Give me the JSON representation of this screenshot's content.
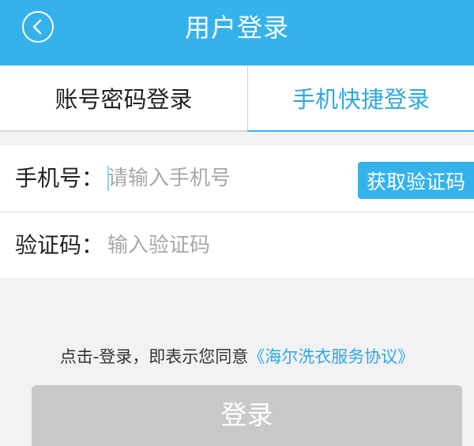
{
  "header": {
    "title": "用户登录",
    "back_icon": "chevron-left-icon"
  },
  "tabs": [
    {
      "label": "账号密码登录",
      "active": false
    },
    {
      "label": "手机快捷登录",
      "active": true
    }
  ],
  "form": {
    "phone": {
      "label": "手机号：",
      "value": "",
      "placeholder": "请输入手机号"
    },
    "get_code_label": "获取验证码",
    "code": {
      "label": "验证码：",
      "value": "",
      "placeholder": "输入验证码"
    }
  },
  "agreement": {
    "prefix": "点击-登录，即表示您同意",
    "link": "《海尔洗衣服务协议》"
  },
  "login_label": "登录",
  "colors": {
    "accent": "#35b2ec",
    "link": "#2ea8e3",
    "disabled_button": "#c9c9cb",
    "background": "#f2f2f4"
  }
}
